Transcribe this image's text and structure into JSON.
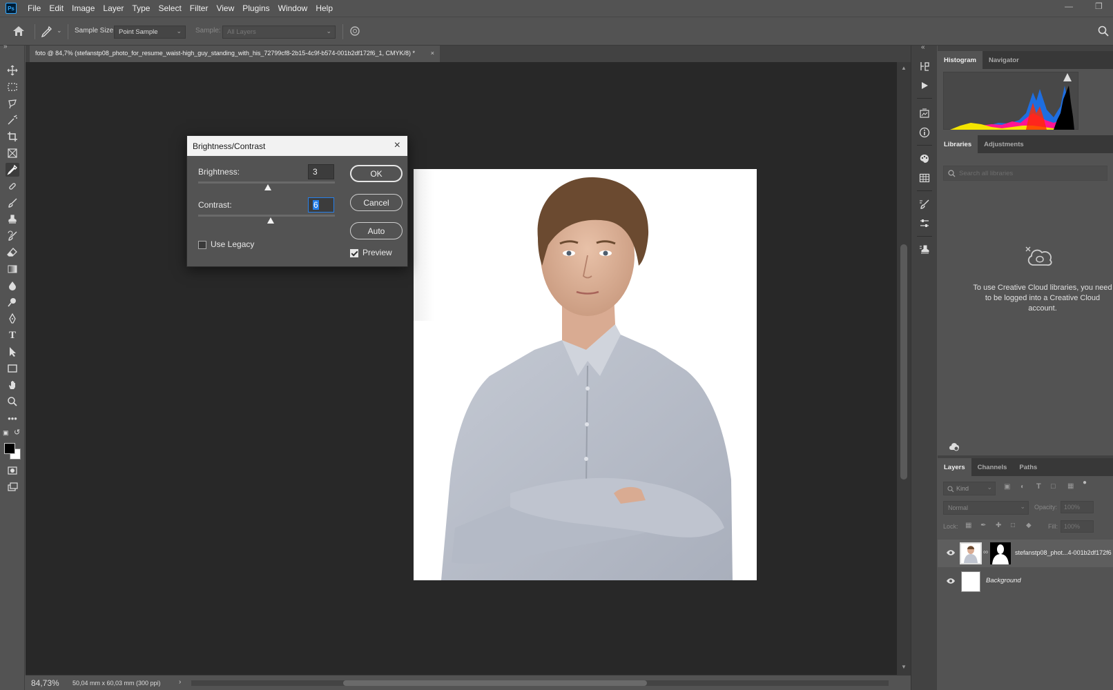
{
  "app": {
    "logo": "Ps"
  },
  "menu": [
    "File",
    "Edit",
    "Image",
    "Layer",
    "Type",
    "Select",
    "Filter",
    "View",
    "Plugins",
    "Window",
    "Help"
  ],
  "options": {
    "sample_size_label": "Sample Size:",
    "sample_size_value": "Point Sample",
    "sample_label": "Sample:",
    "sample_value": "All Layers"
  },
  "document": {
    "tab_title": "foto @ 84,7% (stefanstp08_photo_for_resume_waist-high_guy_standing_with_his_72799cf8-2b15-4c9f-b574-001b2df172f6_1, CMYK/8) *"
  },
  "status": {
    "zoom": "84,73%",
    "doc_size": "50,04 mm x 60,03 mm (300 ppi)"
  },
  "dialog": {
    "title": "Brightness/Contrast",
    "brightness_label": "Brightness:",
    "brightness_value": "3",
    "contrast_label": "Contrast:",
    "contrast_value": "6",
    "use_legacy_label": "Use Legacy",
    "use_legacy_checked": false,
    "preview_label": "Preview",
    "preview_checked": true,
    "ok_label": "OK",
    "cancel_label": "Cancel",
    "auto_label": "Auto"
  },
  "panels": {
    "top_tabs": [
      "Histogram",
      "Navigator"
    ],
    "mid_tabs": [
      "Libraries",
      "Adjustments"
    ],
    "search_placeholder": "Search all libraries",
    "cc_message": "To use Creative Cloud libraries, you need to be logged into a Creative Cloud account.",
    "layers_tabs": [
      "Layers",
      "Channels",
      "Paths"
    ],
    "kind_label": "Kind",
    "blend_mode": "Normal",
    "opacity_label": "Opacity:",
    "opacity_value": "100%",
    "lock_label": "Lock:",
    "fill_label": "Fill:",
    "fill_value": "100%",
    "layers": [
      {
        "name": "stefanstp08_phot...4-001b2df172f6"
      },
      {
        "name": "Background"
      }
    ]
  },
  "colors": {
    "accent": "#2680eb",
    "canvas_bg": "#282828",
    "panel_bg": "#535353"
  }
}
